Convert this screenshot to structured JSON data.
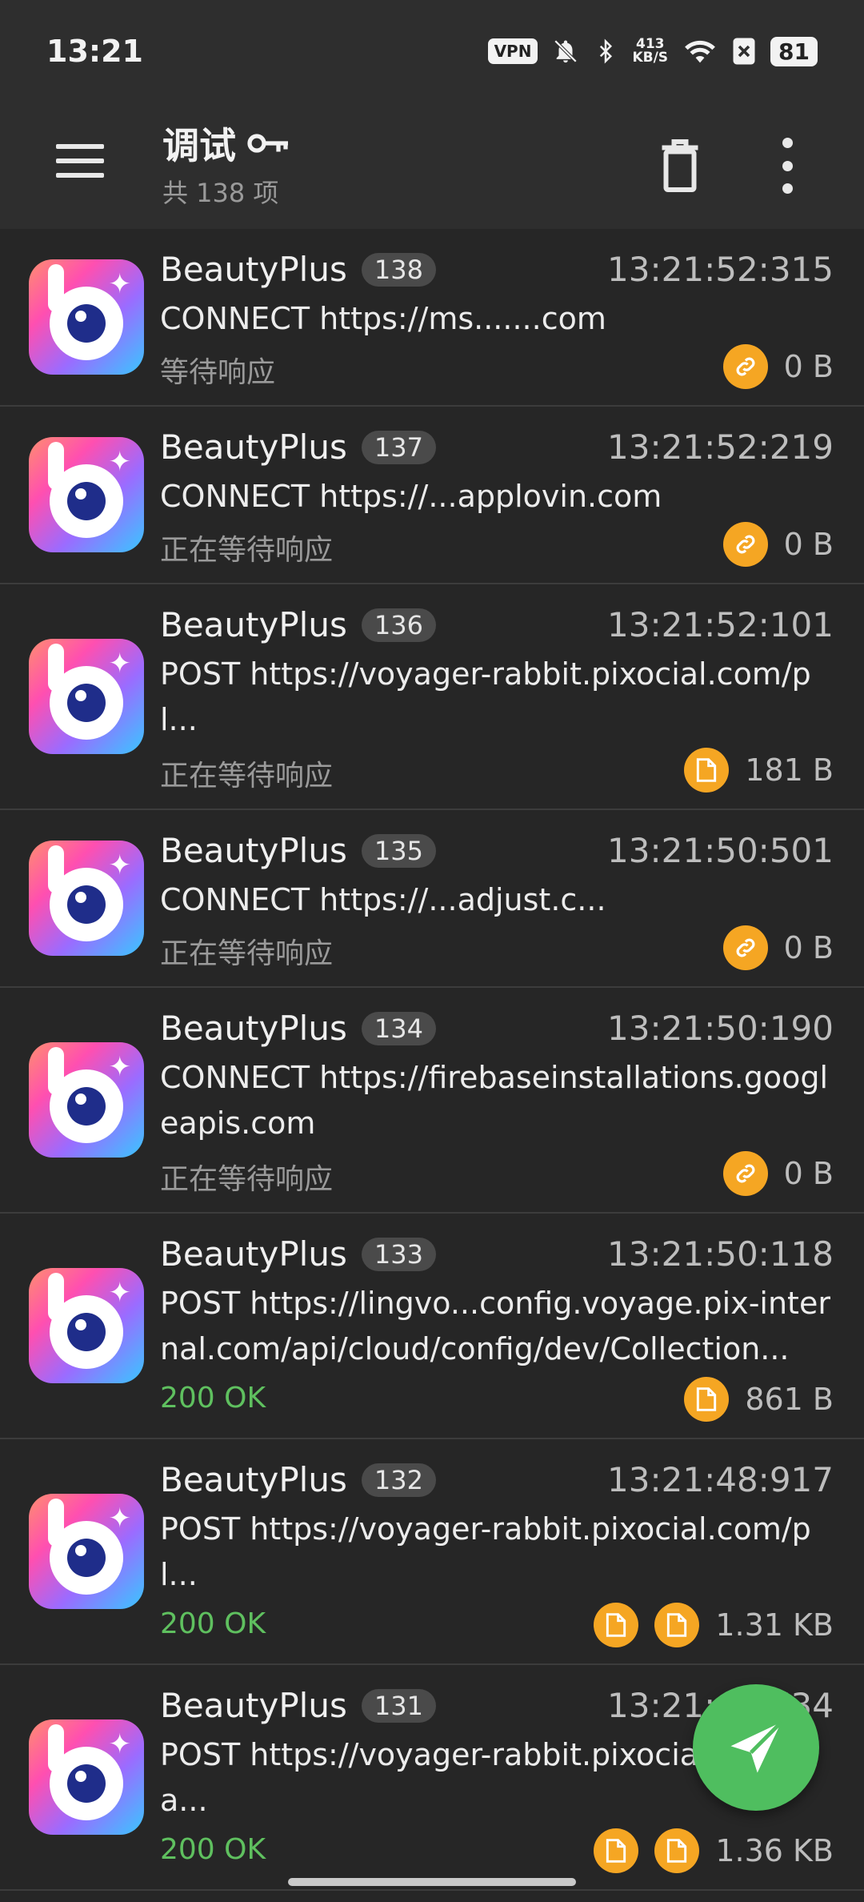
{
  "statusbar": {
    "time": "13:21",
    "vpn": "VPN",
    "speed_value": "413",
    "speed_unit": "KB/S",
    "battery": "81"
  },
  "toolbar": {
    "title": "调试",
    "subtitle": "共 138 项"
  },
  "requests": [
    {
      "app": "BeautyPlus",
      "num": "138",
      "time": "13:21:52:315",
      "url": "CONNECT https://ms.......com",
      "status": "等待响应",
      "status_ok": false,
      "size": "0 B"
    },
    {
      "app": "BeautyPlus",
      "num": "137",
      "time": "13:21:52:219",
      "url": "CONNECT https://...applovin.com",
      "status": "正在等待响应",
      "status_ok": false,
      "size": "0 B"
    },
    {
      "app": "BeautyPlus",
      "num": "136",
      "time": "13:21:52:101",
      "url": "POST https://voyager-rabbit.pixocial.com/pl...",
      "status": "正在等待响应",
      "status_ok": false,
      "size": "181 B"
    },
    {
      "app": "BeautyPlus",
      "num": "135",
      "time": "13:21:50:501",
      "url": "CONNECT https://...adjust.c...",
      "status": "正在等待响应",
      "status_ok": false,
      "size": "0 B"
    },
    {
      "app": "BeautyPlus",
      "num": "134",
      "time": "13:21:50:190",
      "url": "CONNECT https://firebaseinstallations.googleapis.com",
      "status": "正在等待响应",
      "status_ok": false,
      "size": "0 B"
    },
    {
      "app": "BeautyPlus",
      "num": "133",
      "time": "13:21:50:118",
      "url": "POST https://lingvo...config.voyage.pix-internal.com/api/cloud/config/dev/Collection...",
      "status": "200 OK",
      "status_ok": true,
      "size": "861 B"
    },
    {
      "app": "BeautyPlus",
      "num": "132",
      "time": "13:21:48:917",
      "url": "POST https://voyager-rabbit.pixocial.com/pl...",
      "status": "200 OK",
      "status_ok": true,
      "size": "1.31 KB"
    },
    {
      "app": "BeautyPlus",
      "num": "131",
      "time": "13:21:48:734",
      "url": "POST https://voyager-rabbit.pixocial.com/pla...",
      "status": "200 OK",
      "status_ok": true,
      "size": "1.36 KB"
    }
  ]
}
